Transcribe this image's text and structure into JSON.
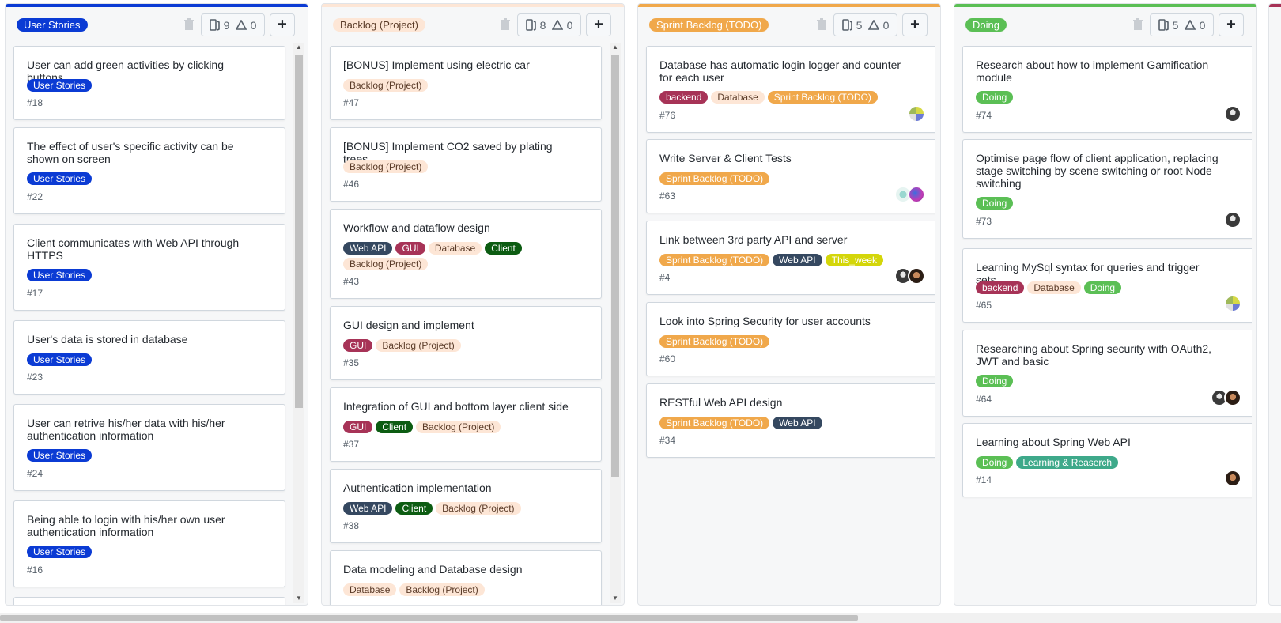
{
  "colors": {
    "user_stories": "#0b3bd4",
    "backlog": "#fde6d6",
    "sprint": "#f0a84b",
    "doing": "#5bbf55",
    "backend": "#a73357",
    "database": "#fde6d6",
    "web_api": "#354860",
    "gui": "#a73357",
    "client": "#0c5c12",
    "this_week": "#d4d60a",
    "learning": "#3ea98a"
  },
  "columns": [
    {
      "name": "User Stories",
      "cards_count": "9",
      "alerts_count": "0",
      "cards": [
        {
          "title": "User can add green activities by clicking buttons",
          "tags": [
            "User Stories"
          ],
          "number": "#18"
        },
        {
          "title": "The effect of user's specific activity can be shown on screen",
          "tags": [
            "User Stories"
          ],
          "number": "#22"
        },
        {
          "title": "Client communicates with Web API through HTTPS",
          "tags": [
            "User Stories"
          ],
          "number": "#17"
        },
        {
          "title": "User's data is stored in database",
          "tags": [
            "User Stories"
          ],
          "number": "#23"
        },
        {
          "title": "User can retrive his/her data with his/her authentication information",
          "tags": [
            "User Stories"
          ],
          "number": "#24"
        },
        {
          "title": "Being able to login with his/her own user authentication information",
          "tags": [
            "User Stories"
          ],
          "number": "#16"
        }
      ]
    },
    {
      "name": "Backlog (Project)",
      "cards_count": "8",
      "alerts_count": "0",
      "cards": [
        {
          "title": "[BONUS] Implement using electric car",
          "tags": [
            "Backlog (Project)"
          ],
          "number": "#47"
        },
        {
          "title": "[BONUS] Implement CO2 saved by plating trees",
          "tags": [
            "Backlog (Project)"
          ],
          "number": "#46"
        },
        {
          "title": "Workflow and dataflow design",
          "tags": [
            "Web API",
            "GUI",
            "Database",
            "Client",
            "Backlog (Project)"
          ],
          "number": "#43"
        },
        {
          "title": "GUI design and implement",
          "tags": [
            "GUI",
            "Backlog (Project)"
          ],
          "number": "#35"
        },
        {
          "title": "Integration of GUI and bottom layer client side",
          "tags": [
            "GUI",
            "Client",
            "Backlog (Project)"
          ],
          "number": "#37"
        },
        {
          "title": "Authentication implementation",
          "tags": [
            "Web API",
            "Client",
            "Backlog (Project)"
          ],
          "number": "#38"
        },
        {
          "title": "Data modeling and Database design",
          "tags": [
            "Database",
            "Backlog (Project)"
          ],
          "number": ""
        }
      ]
    },
    {
      "name": "Sprint Backlog (TODO)",
      "cards_count": "5",
      "alerts_count": "0",
      "cards": [
        {
          "title": "Database has automatic login logger and counter for each user",
          "tags": [
            "backend",
            "Database",
            "Sprint Backlog (TODO)"
          ],
          "number": "#76",
          "avatars": [
            "a"
          ]
        },
        {
          "title": "Write Server & Client Tests",
          "tags": [
            "Sprint Backlog (TODO)"
          ],
          "number": "#63",
          "avatars": [
            "b",
            "c"
          ]
        },
        {
          "title": "Link between 3rd party API and server",
          "tags": [
            "Sprint Backlog (TODO)",
            "Web API",
            "This_week"
          ],
          "number": "#4",
          "avatars": [
            "d",
            "e"
          ]
        },
        {
          "title": "Look into Spring Security for user accounts",
          "tags": [
            "Sprint Backlog (TODO)"
          ],
          "number": "#60"
        },
        {
          "title": "RESTful Web API design",
          "tags": [
            "Sprint Backlog (TODO)",
            "Web API"
          ],
          "number": "#34"
        }
      ]
    },
    {
      "name": "Doing",
      "cards_count": "5",
      "alerts_count": "0",
      "cards": [
        {
          "title": "Research about how to implement Gamification module",
          "tags": [
            "Doing"
          ],
          "number": "#74",
          "avatars": [
            "d"
          ]
        },
        {
          "title": "Optimise page flow of client application, replacing stage switching by scene switching or root Node switching",
          "tags": [
            "Doing"
          ],
          "number": "#73",
          "avatars": [
            "d"
          ]
        },
        {
          "title": "Learning MySql syntax for queries and trigger sets",
          "tags": [
            "backend",
            "Database",
            "Doing"
          ],
          "number": "#65",
          "avatars": [
            "a"
          ]
        },
        {
          "title": "Researching about Spring security with OAuth2, JWT and basic",
          "tags": [
            "Doing"
          ],
          "number": "#64",
          "avatars": [
            "d",
            "e"
          ]
        },
        {
          "title": "Learning about Spring Web API",
          "tags": [
            "Doing",
            "Learning & Reaserch"
          ],
          "number": "#14",
          "avatars": [
            "e"
          ]
        }
      ]
    }
  ]
}
